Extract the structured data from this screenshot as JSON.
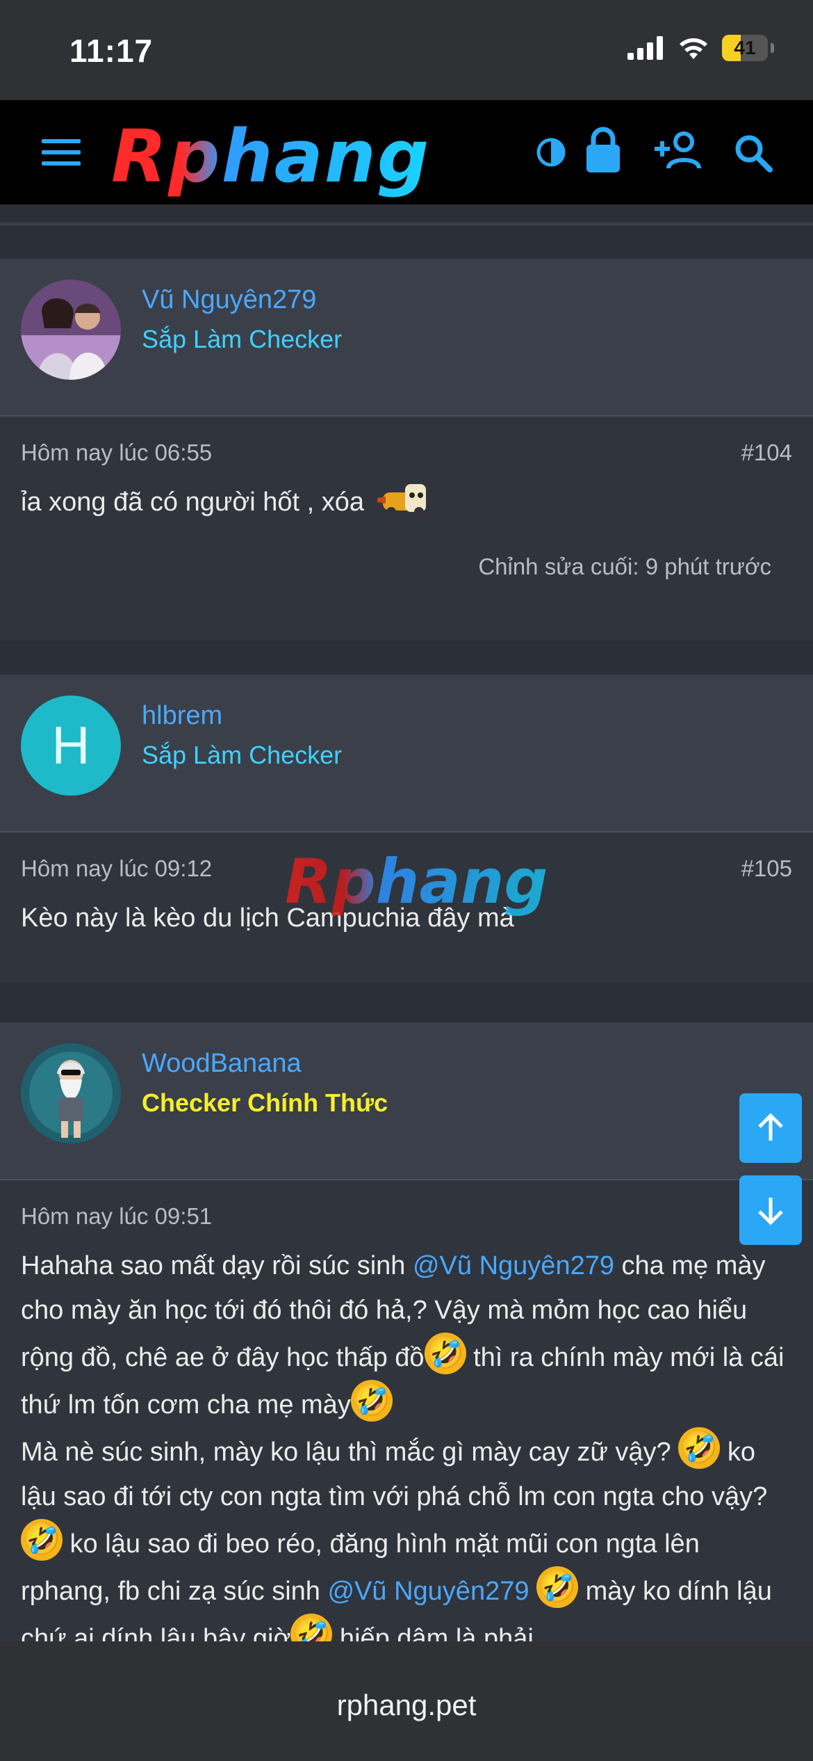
{
  "status_bar": {
    "time": "11:17",
    "battery": "41",
    "battery_level": 0.41
  },
  "site": {
    "logo_text": "Rphang",
    "watermark_text": "Rphang"
  },
  "posts": [
    {
      "username": "Vũ Nguyên279",
      "user_title": "Sắp Làm Checker",
      "date": "Hôm nay lúc 06:55",
      "number": "#104",
      "text": "ỉa xong đã có người hốt , xóa",
      "edited": "Chỉnh sửa cuối: 9 phút trước"
    },
    {
      "username": "hlbrem",
      "avatar_letter": "H",
      "user_title": "Sắp Làm Checker",
      "date": "Hôm nay lúc 09:12",
      "number": "#105",
      "text": "Kèo này là kèo du lịch Campuchia đây mà"
    },
    {
      "username": "WoodBanana",
      "user_title": "Checker Chính Thức",
      "date": "Hôm nay lúc 09:51",
      "number": "#",
      "text_parts": {
        "p1": "Hahaha sao mất dạy rồi súc sinh ",
        "mention1": "@Vũ Nguyên279",
        "p2": " cha mẹ mày cho mày ăn học tới đó thôi đó hả,? Vậy mà mỏm học cao hiểu rộng đồ, chê ae ở đây học thấp đồ",
        "p3": " thì ra chính mày mới là cái thứ lm tốn cơm cha mẹ mày",
        "p4": "Mà nè súc sinh, mày ko lậu thì mắc gì mày cay zữ vậy? ",
        "p5": " ko lậu sao đi tới cty con ngta tìm với phá chỗ lm con ngta cho vậy? ",
        "p6": " ko lậu sao đi beo réo, đăng hình mặt mũi con ngta lên rphang, fb chi zạ súc sinh ",
        "mention2": "@Vũ Nguyên279",
        "p7": " mày ko dính lậu chứ ai dính lậu bây giờ",
        "p8": " hiếp dâm là phải"
      }
    }
  ],
  "footer": {
    "url": "rphang.pet"
  },
  "icons": [
    "menu-icon",
    "contrast-icon",
    "lock-icon",
    "add-user-icon",
    "search-icon",
    "arrow-up-icon",
    "arrow-down-icon",
    "rofl-emoji"
  ],
  "colors": {
    "link": "#4aa9ff",
    "title_cyan": "#3fd2ff",
    "title_yellow": "#f6ef2a",
    "fab": "#2aa8f6"
  }
}
